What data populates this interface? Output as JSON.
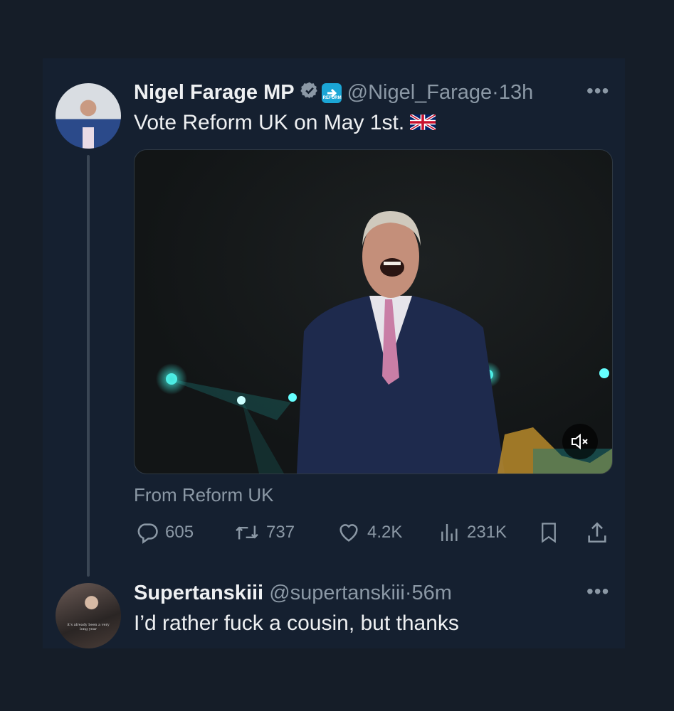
{
  "tweet": {
    "author_name": "Nigel Farage MP",
    "handle": "@Nigel_Farage",
    "time": "13h",
    "text": "Vote Reform UK on May 1st.",
    "org_badge_text": "REFORM",
    "flag_icon": "uk-flag-icon",
    "media_source": "From Reform UK",
    "stats": {
      "replies": "605",
      "reposts": "737",
      "likes": "4.2K",
      "views": "231K"
    }
  },
  "reply": {
    "author_name": "Supertanskiii",
    "handle": "@supertanskiii",
    "time": "56m",
    "text": "I’d rather fuck a cousin, but thanks",
    "avatar_caption": "it’s already been a very long year"
  },
  "ui": {
    "dot_sep": "·",
    "more_label": "•••",
    "accent": "#1d9bf0"
  }
}
